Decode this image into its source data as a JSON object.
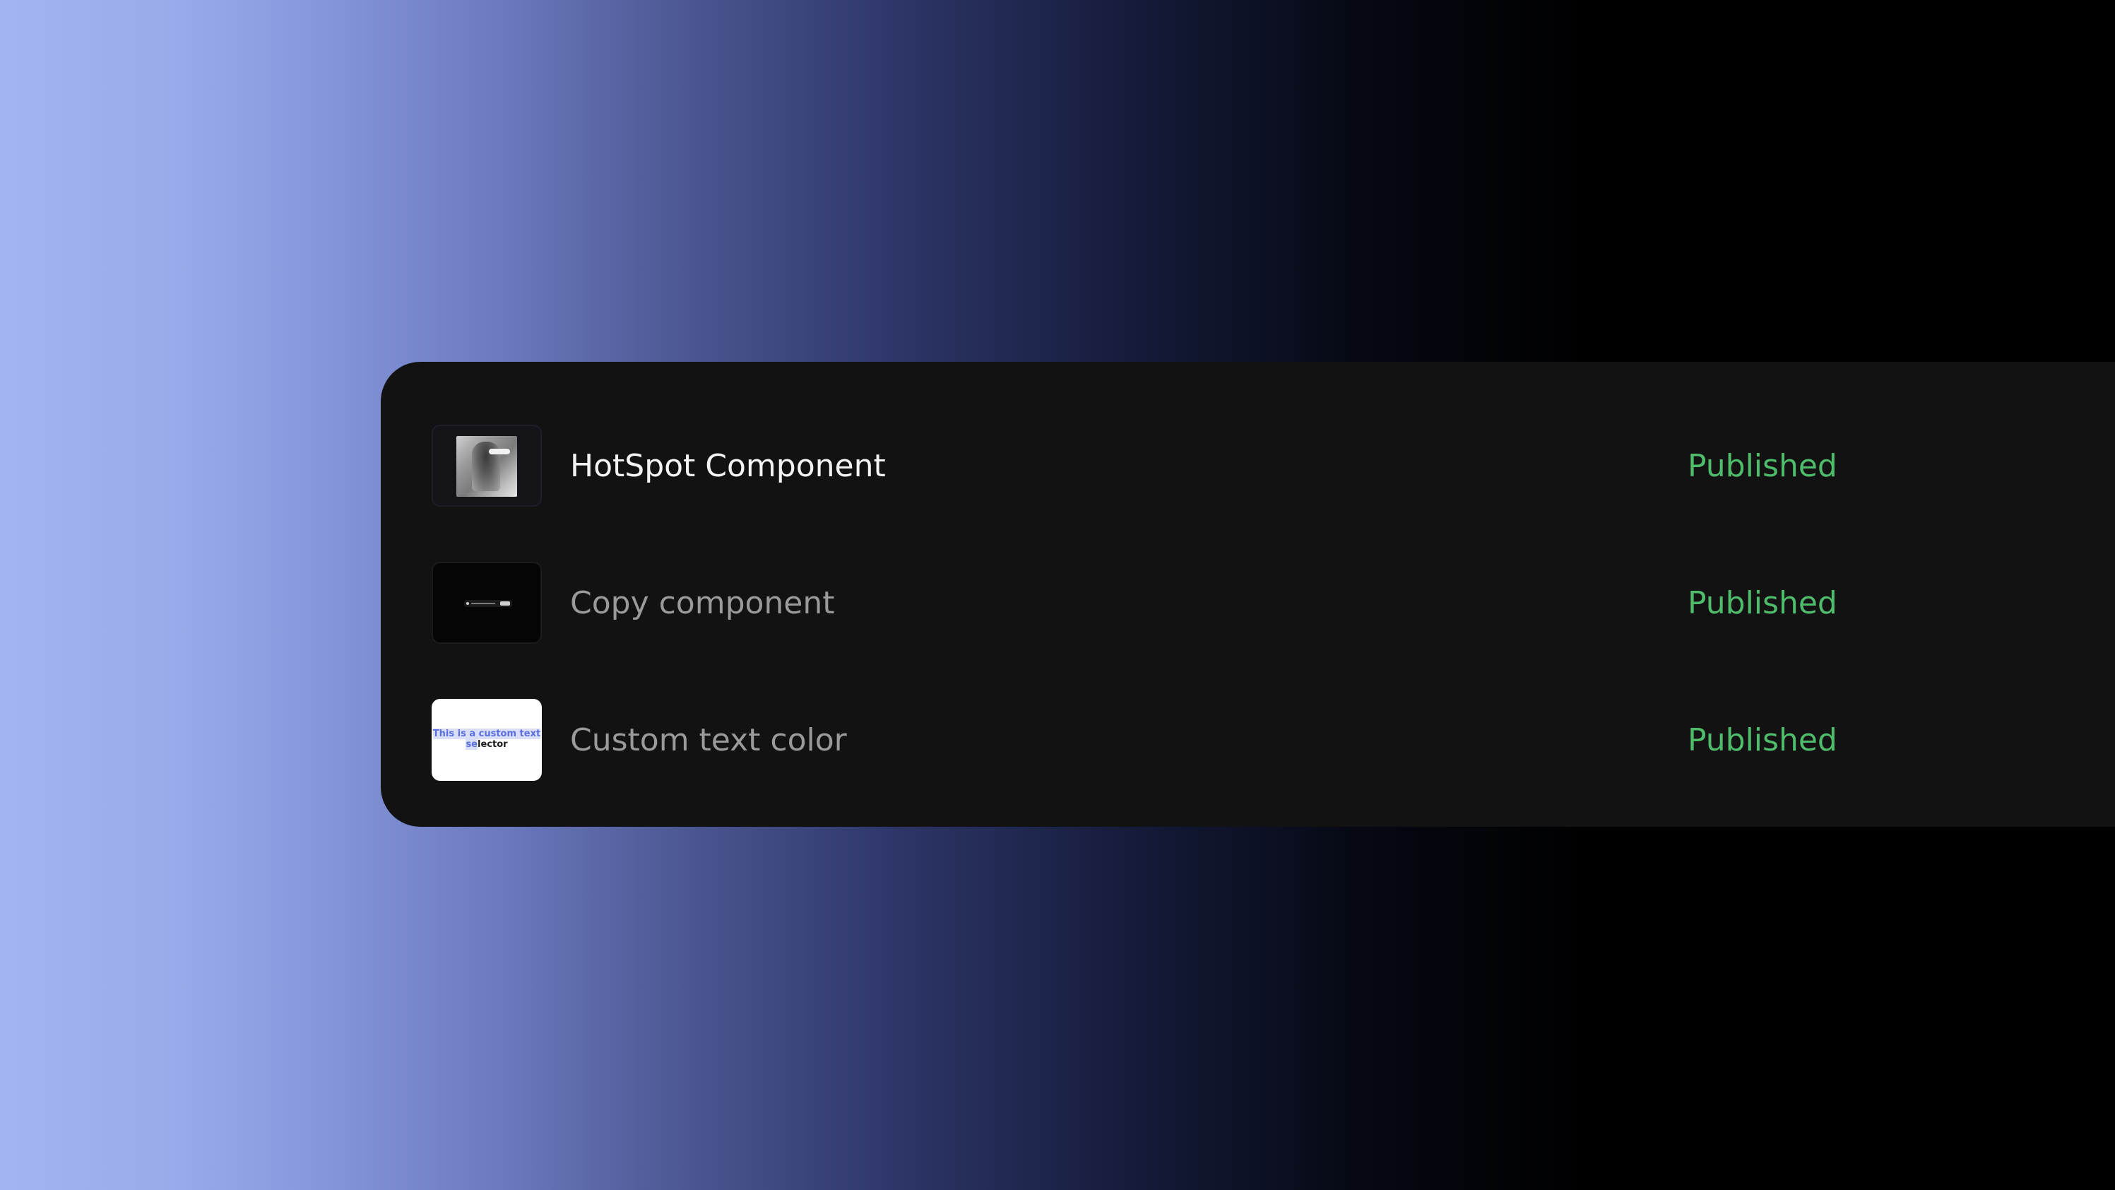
{
  "list": {
    "items": [
      {
        "name": "HotSpot Component",
        "status": "Published",
        "thumbnail": "hotspot-photo-thumbnail"
      },
      {
        "name": "Copy component",
        "status": "Published",
        "thumbnail": "copy-bar-thumbnail"
      },
      {
        "name": "Custom text color",
        "status": "Published",
        "thumbnail": "text-selection-thumbnail",
        "thumbnail_text_highlighted": "This is a custom text se",
        "thumbnail_text_plain": "lector"
      }
    ]
  },
  "colors": {
    "status": "#4ebc6b",
    "panel": "#121212",
    "highlight": "#5b6fe0"
  }
}
